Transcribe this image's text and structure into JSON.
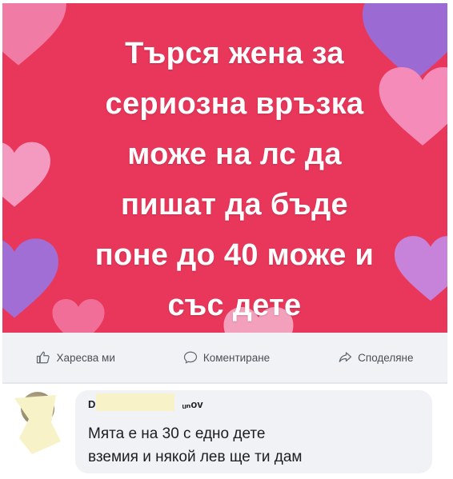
{
  "post": {
    "text_lines": [
      "Търся жена за",
      "сериозна връзка",
      "може на лс да",
      "пишат да бъде",
      "поне до 40 може и",
      "със дете"
    ],
    "background_color": "#e8375a"
  },
  "actions": {
    "like_label": "Харесва ми",
    "comment_label": "Коментиране",
    "share_label": "Споделяне"
  },
  "comment": {
    "author_visible_start": "D·",
    "author_visible_end": "ᵤₙov",
    "text_line1": "Мята е на 30 с едно дете",
    "text_line2": "вземия и някой лев ще ти дам"
  }
}
